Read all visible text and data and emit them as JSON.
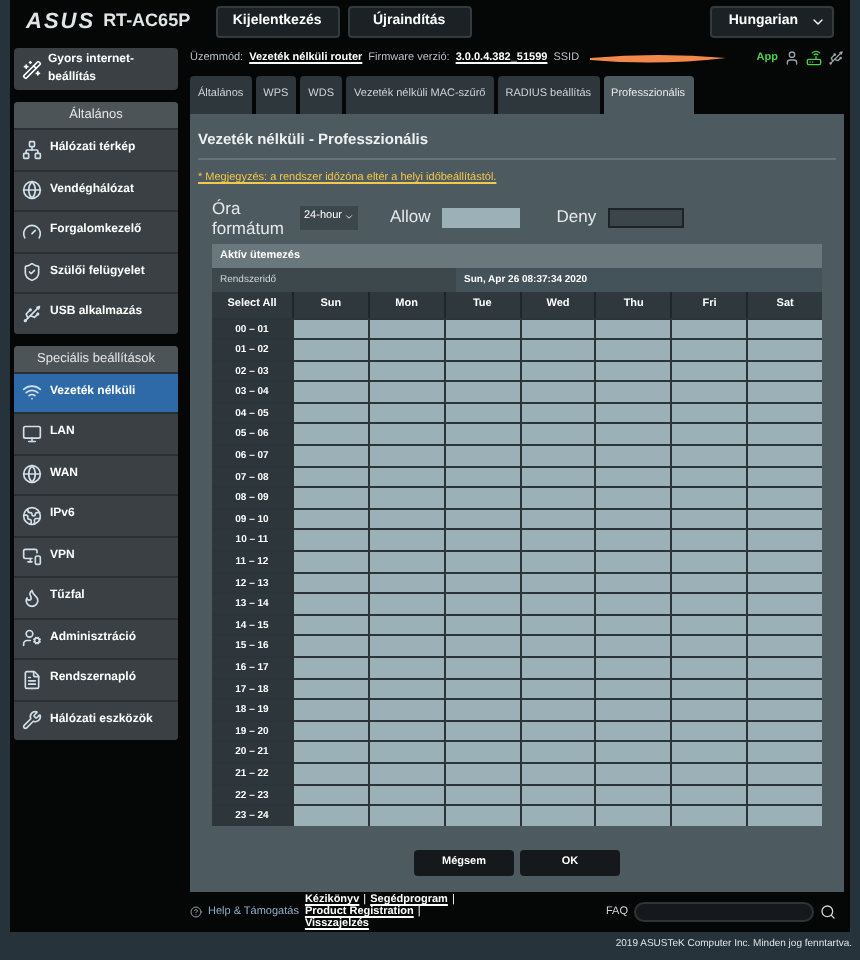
{
  "header": {
    "logo": "ASUS",
    "model": "RT-AC65P",
    "buttons": [
      "Kijelentkezés",
      "Újraindítás"
    ],
    "language": "Hungarian"
  },
  "info": {
    "mode_label": "Üzemmód:",
    "mode": "Vezeték nélküli router",
    "firmware_label": "Firmware verzió:",
    "firmware": "3.0.0.4.382_51599",
    "ssid_label": "SSID",
    "app": "App"
  },
  "sidebar": {
    "quick_setup": "Gyors internet-beállítás",
    "sections": [
      {
        "title": "Általános",
        "items": [
          {
            "label": "Hálózati térkép",
            "selected": false
          },
          {
            "label": "Vendéghálózat",
            "selected": false
          },
          {
            "label": "Forgalomkezelő",
            "selected": false
          },
          {
            "label": "Szülői felügyelet",
            "selected": false
          },
          {
            "label": "USB alkalmazás",
            "selected": false
          }
        ]
      },
      {
        "title": "Speciális beállítások",
        "items": [
          {
            "label": "Vezeték nélküli",
            "selected": true
          },
          {
            "label": "LAN",
            "selected": false
          },
          {
            "label": "WAN",
            "selected": false
          },
          {
            "label": "IPv6",
            "selected": false
          },
          {
            "label": "VPN",
            "selected": false
          },
          {
            "label": "Tűzfal",
            "selected": false
          },
          {
            "label": "Adminisztráció",
            "selected": false
          },
          {
            "label": "Rendszernapló",
            "selected": false
          },
          {
            "label": "Hálózati eszközök",
            "selected": false
          }
        ]
      }
    ]
  },
  "tabs": [
    {
      "label": "Általános",
      "selected": false
    },
    {
      "label": "WPS",
      "selected": false
    },
    {
      "label": "WDS",
      "selected": false
    },
    {
      "label": "Vezeték nélküli MAC-szűrő",
      "selected": false
    },
    {
      "label": "RADIUS beállítás",
      "selected": false
    },
    {
      "label": "Professzionális",
      "selected": true
    }
  ],
  "page_title": "Vezeték nélküli - Professzionális",
  "note": "* Megjegyzés: a rendszer időzóna eltér a helyi időbeállítástól.",
  "hour_format": {
    "label": "Óra formátum",
    "value": "24-hour"
  },
  "legend": {
    "allow": "Allow",
    "deny": "Deny"
  },
  "schedule": {
    "title": "Aktív ütemezés",
    "time_label": "Rendszeridő",
    "time": "Sun, Apr 26 08:37:34 2020",
    "select_all": "Select All",
    "days": [
      "Sun",
      "Mon",
      "Tue",
      "Wed",
      "Thu",
      "Fri",
      "Sat"
    ],
    "hours": [
      "00 – 01",
      "01 – 02",
      "02 – 03",
      "03 – 04",
      "04 – 05",
      "05 – 06",
      "06 – 07",
      "07 – 08",
      "08 – 09",
      "09 – 10",
      "10 – 11",
      "11 – 12",
      "12 – 13",
      "13 – 14",
      "14 – 15",
      "15 – 16",
      "16 – 17",
      "17 – 18",
      "18 – 19",
      "19 – 20",
      "20 – 21",
      "21 – 22",
      "22 – 23",
      "23 – 24"
    ]
  },
  "buttons": {
    "cancel": "Mégsem",
    "ok": "OK"
  },
  "footer": {
    "help": "Help & Támogatás",
    "links": [
      "Kézikönyv",
      "Segédprogram",
      "Product Registration",
      "Visszajelzés"
    ],
    "separator": "|",
    "faq": "FAQ",
    "copyright": "2019 ASUSTeK Computer Inc. Minden jog fenntartva."
  }
}
